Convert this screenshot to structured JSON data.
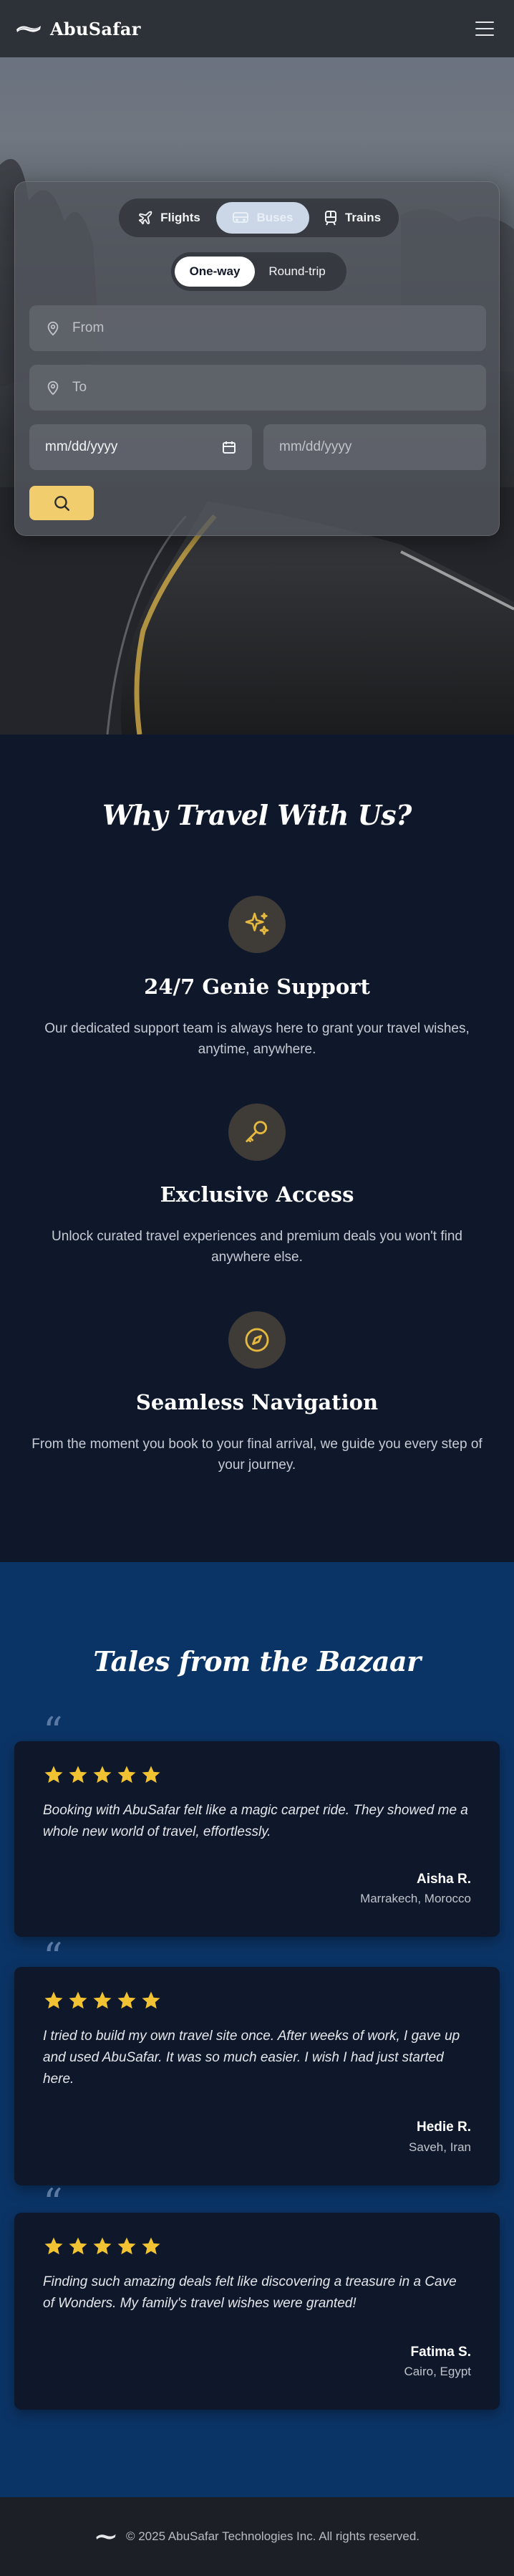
{
  "brand": {
    "name": "AbuSafar"
  },
  "colors": {
    "accent": "#f1cd6d",
    "nav": "#2d3138",
    "section_dark": "#0f172a",
    "section_blue": "#0b3466",
    "footer": "#1d1f26"
  },
  "search": {
    "modes": [
      {
        "label": "Flights",
        "icon": "plane-icon"
      },
      {
        "label": "Buses",
        "icon": "bus-icon",
        "selected": true
      },
      {
        "label": "Trains",
        "icon": "train-icon"
      }
    ],
    "trip_types": [
      {
        "label": "One-way",
        "selected": true
      },
      {
        "label": "Round-trip"
      }
    ],
    "from_placeholder": "From",
    "to_placeholder": "To",
    "depart_date": "mm/dd/yyyy",
    "return_date_placeholder": "mm/dd/yyyy",
    "search_icon": "search-icon"
  },
  "why": {
    "title": "Why Travel With Us?",
    "features": [
      {
        "icon": "sparkles-icon",
        "title": "24/7 Genie Support",
        "desc": "Our dedicated support team is always here to grant your travel wishes, anytime, anywhere."
      },
      {
        "icon": "key-icon",
        "title": "Exclusive Access",
        "desc": "Unlock curated travel experiences and premium deals you won't find anywhere else."
      },
      {
        "icon": "compass-icon",
        "title": "Seamless Navigation",
        "desc": "From the moment you book to your final arrival, we guide you every step of your journey."
      }
    ]
  },
  "tales": {
    "title": "Tales from the Bazaar",
    "quote_glyph": "“",
    "testimonials": [
      {
        "rating": 5,
        "text": "Booking with AbuSafar felt like a magic carpet ride. They showed me a whole new world of travel, effortlessly.",
        "name": "Aisha R.",
        "location": "Marrakech, Morocco"
      },
      {
        "rating": 5,
        "text": "I tried to build my own travel site once. After weeks of work, I gave up and used AbuSafar. It was so much easier. I wish I had just started here.",
        "name": "Hedie R.",
        "location": "Saveh, Iran"
      },
      {
        "rating": 5,
        "text": "Finding such amazing deals felt like discovering a treasure in a Cave of Wonders. My family's travel wishes were granted!",
        "name": "Fatima S.",
        "location": "Cairo, Egypt"
      }
    ]
  },
  "footer": {
    "text": "© 2025 AbuSafar Technologies Inc. All rights reserved."
  }
}
